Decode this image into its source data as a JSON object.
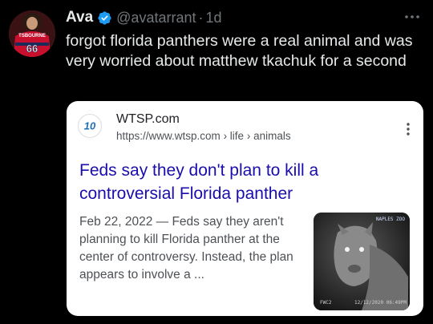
{
  "tweet": {
    "author": {
      "display_name": "Ava",
      "handle": "@avatarrant",
      "separator": "·",
      "time": "1d",
      "avatar_jersey_name": "TSBOURNE",
      "avatar_jersey_number": "66"
    },
    "text": "forgot florida panthers were a real animal and was very worried about matthew tkachuk for a second",
    "card": {
      "site_name": "WTSP.com",
      "site_url": "https://www.wtsp.com",
      "breadcrumb": "› life › animals",
      "logo_text": "10",
      "title": "Feds say they don't plan to kill a controversial Florida panther",
      "snippet": "Feb 22, 2022 — Feds say they aren't planning to kill Florida panther at the center of controversy. Instead, the plan appears to involve a ...",
      "thumbnail": {
        "corner_tag": "NAPLES ZOO",
        "cam_id": "FWC2",
        "timestamp": "12/12/2020 06:49PM"
      }
    }
  },
  "colors": {
    "background": "#000000",
    "text": "#e7e9ea",
    "muted": "#71767b",
    "verified": "#1d9bf0",
    "link": "#1a0dab",
    "snippet": "#4d5156"
  },
  "icons": {
    "verified": "verified-badge-icon",
    "more": "more-horizontal-icon",
    "kebab": "more-vertical-icon"
  }
}
